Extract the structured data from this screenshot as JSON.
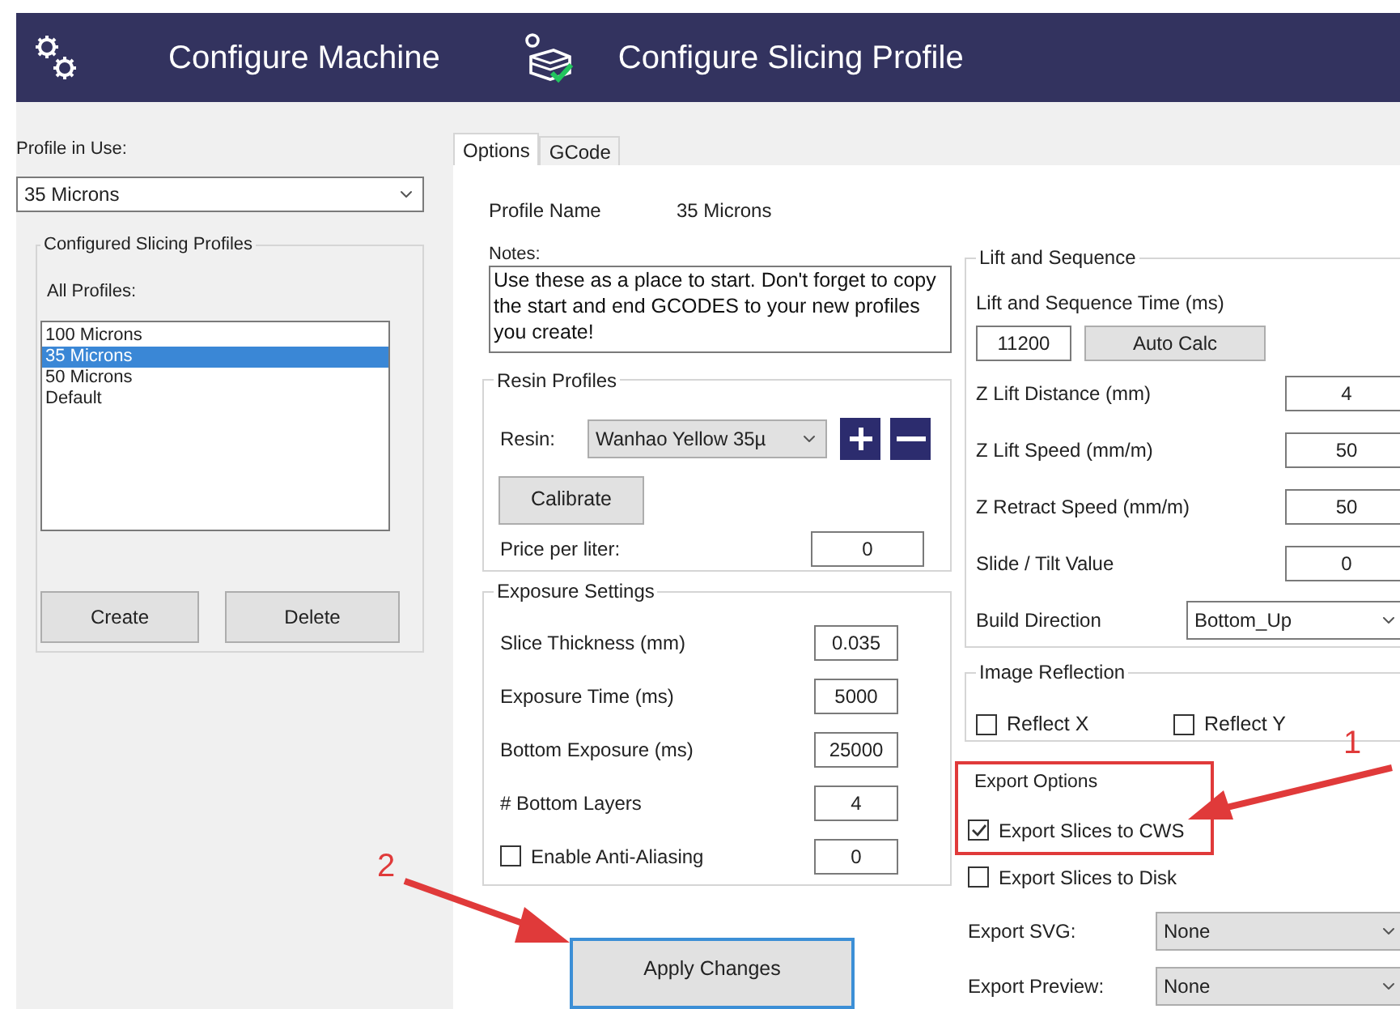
{
  "header": {
    "items": [
      {
        "kind": "machine",
        "label": "Configure Machine"
      },
      {
        "kind": "profile",
        "label": "Configure Slicing Profile"
      }
    ]
  },
  "sidebar": {
    "profile_in_use": {
      "label": "Profile in Use:",
      "value": "35 Microns"
    },
    "group": {
      "title": "Configured Slicing Profiles",
      "list_label": "All Profiles:",
      "profiles": [
        {
          "name": "100 Microns",
          "selected": false
        },
        {
          "name": "35 Microns",
          "selected": true
        },
        {
          "name": "50 Microns",
          "selected": false
        },
        {
          "name": "Default",
          "selected": false
        }
      ],
      "buttons": [
        "Create",
        "Delete"
      ]
    }
  },
  "tabs": [
    {
      "label": "Options",
      "selected": true
    },
    {
      "label": "GCode",
      "selected": false
    }
  ],
  "options": {
    "profile_name": {
      "label": "Profile Name",
      "value": "35 Microns"
    },
    "notes": {
      "label": "Notes:",
      "value": "Use these as a place to start. Don't forget to copy the start and end GCODES to your new profiles you create!"
    },
    "resin_profiles": {
      "title": "Resin Profiles",
      "resin": {
        "label": "Resin:",
        "value": "Wanhao Yellow 35µ"
      },
      "calibrate": "Calibrate",
      "price": {
        "label": "Price per liter:",
        "value": "0"
      }
    },
    "exposure_settings": {
      "title": "Exposure Settings",
      "rows": [
        {
          "kind": "field",
          "label": "Slice Thickness (mm)",
          "value": "0.035"
        },
        {
          "kind": "field",
          "label": "Exposure Time (ms)",
          "value": "5000"
        },
        {
          "kind": "field",
          "label": "Bottom Exposure (ms)",
          "value": "25000"
        },
        {
          "kind": "field",
          "label": "# Bottom Layers",
          "value": "4"
        },
        {
          "kind": "checkbox",
          "label": "Enable Anti-Aliasing",
          "value": "0",
          "checked": false
        }
      ]
    },
    "apply_button": "Apply Changes",
    "lift_and_sequence": {
      "title": "Lift and Sequence",
      "time": {
        "label": "Lift and Sequence Time (ms)",
        "value": "11200",
        "button": "Auto Calc"
      },
      "rows": [
        {
          "kind": "field",
          "label": "Z Lift Distance (mm)",
          "value": "4"
        },
        {
          "kind": "field",
          "label": "Z Lift Speed (mm/m)",
          "value": "50"
        },
        {
          "kind": "field",
          "label": "Z Retract Speed (mm/m)",
          "value": "50"
        },
        {
          "kind": "field",
          "label": "Slide / Tilt Value",
          "value": "0"
        },
        {
          "kind": "dropdown",
          "label": "Build Direction",
          "value": "Bottom_Up"
        }
      ]
    },
    "image_reflection": {
      "title": "Image Reflection",
      "checkboxes": [
        {
          "label": "Reflect X",
          "checked": false
        },
        {
          "label": "Reflect Y",
          "checked": false
        }
      ]
    },
    "export_options": {
      "title": "Export Options",
      "checkboxes": [
        {
          "label": "Export Slices to CWS",
          "checked": true
        },
        {
          "label": "Export Slices to Disk",
          "checked": false
        }
      ],
      "dropdowns": [
        {
          "label": "Export SVG:",
          "value": "None"
        },
        {
          "label": "Export Preview:",
          "value": "None"
        }
      ]
    }
  },
  "annotations": [
    {
      "label": "1"
    },
    {
      "label": "2"
    }
  ]
}
